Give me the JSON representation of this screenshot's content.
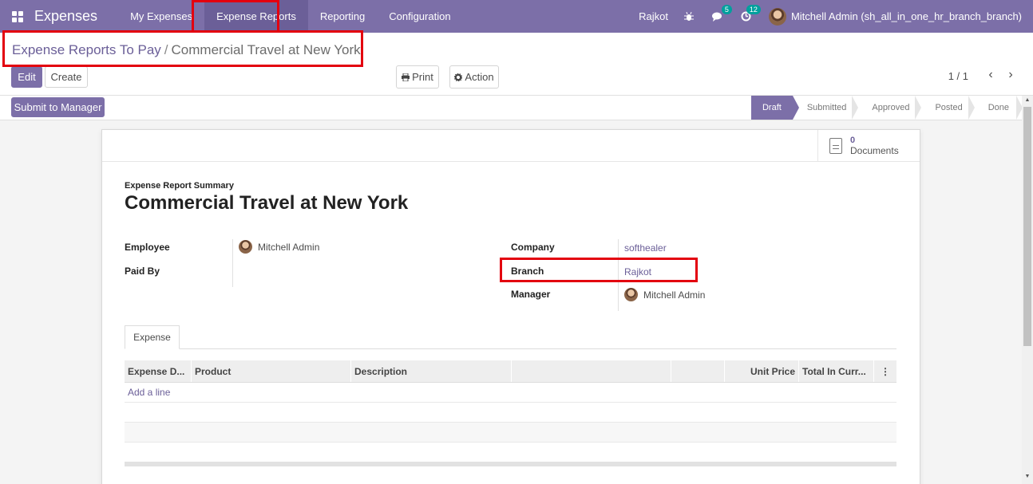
{
  "navbar": {
    "brand": "Expenses",
    "menu": [
      "My Expenses",
      "Expense Reports",
      "Reporting",
      "Configuration"
    ],
    "branch": "Rajkot",
    "chat_badge": "5",
    "activity_badge": "12",
    "user": "Mitchell Admin (sh_all_in_one_hr_branch_branch)"
  },
  "breadcrumb": {
    "parent": "Expense Reports To Pay",
    "separator": "/",
    "current": "Commercial Travel at New York"
  },
  "toolbar": {
    "edit_label": "Edit",
    "create_label": "Create",
    "print_label": "Print",
    "action_label": "Action",
    "pager": "1 / 1"
  },
  "statusbar": {
    "submit_label": "Submit to Manager",
    "stages": [
      "Draft",
      "Submitted",
      "Approved",
      "Posted",
      "Done"
    ],
    "active_stage": "Draft"
  },
  "sheet": {
    "documents_count": "0",
    "documents_label": "Documents",
    "summary_label": "Expense Report Summary",
    "title": "Commercial Travel at New York",
    "fields": {
      "employee_label": "Employee",
      "employee_value": "Mitchell Admin",
      "paid_by_label": "Paid By",
      "company_label": "Company",
      "company_value": "softhealer",
      "branch_label": "Branch",
      "branch_value": "Rajkot",
      "manager_label": "Manager",
      "manager_value": "Mitchell Admin"
    },
    "tab_label": "Expense",
    "table": {
      "columns": [
        "Expense D...",
        "Product",
        "Description",
        "",
        "",
        "Unit Price",
        "Total In Curr..."
      ],
      "add_line": "Add a line"
    }
  },
  "colors": {
    "brand": "#7c6fa8",
    "highlight": "#e3000f"
  }
}
